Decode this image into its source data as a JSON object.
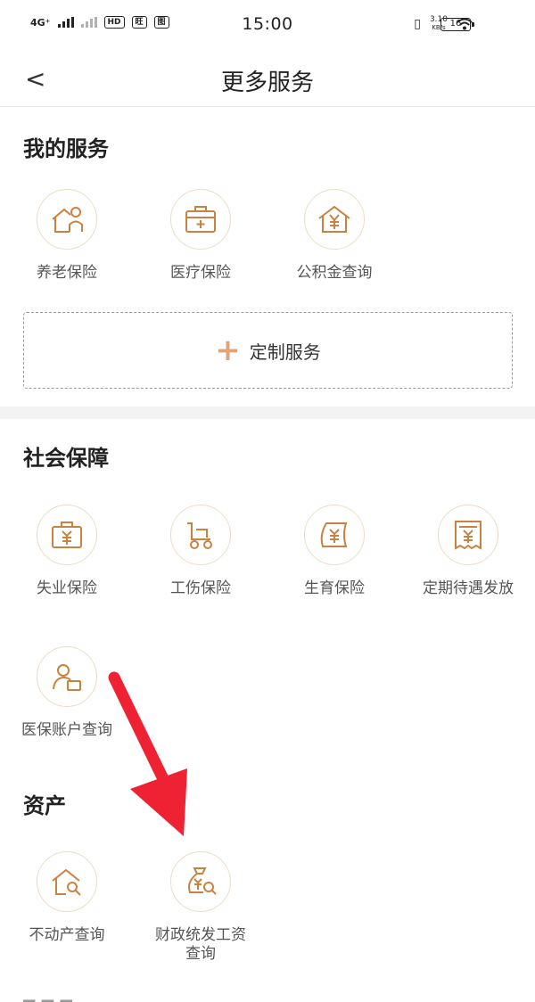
{
  "status": {
    "network": "4G⁺",
    "time": "15:00",
    "hd": "HD",
    "speed": "3.10",
    "speed_unit": "KB/s",
    "battery": "16"
  },
  "nav": {
    "back": "<",
    "title": "更多服务"
  },
  "my_services": {
    "title": "我的服务",
    "items": [
      {
        "label": "养老保险",
        "icon": "house-person-icon"
      },
      {
        "label": "医疗保险",
        "icon": "medical-kit-icon"
      },
      {
        "label": "公积金查询",
        "icon": "house-yuan-icon"
      }
    ],
    "custom_label": "定制服务",
    "custom_plus": "+"
  },
  "social": {
    "title": "社会保障",
    "items": [
      {
        "label": "失业保险",
        "icon": "briefcase-yuan-icon"
      },
      {
        "label": "工伤保险",
        "icon": "wheelchair-icon"
      },
      {
        "label": "生育保险",
        "icon": "pouch-yuan-icon"
      },
      {
        "label": "定期待遇发放",
        "icon": "receipt-yuan-icon"
      },
      {
        "label": "医保账户查询",
        "icon": "person-card-icon"
      }
    ]
  },
  "assets": {
    "title": "资产",
    "items": [
      {
        "label": "不动产查询",
        "icon": "house-search-icon"
      },
      {
        "label": "财政统发工资查询",
        "icon": "money-bag-search-icon"
      }
    ]
  },
  "colors": {
    "accent": "#c9823f",
    "arrow": "#ee2233",
    "circle_border": "#ecdcc8"
  }
}
